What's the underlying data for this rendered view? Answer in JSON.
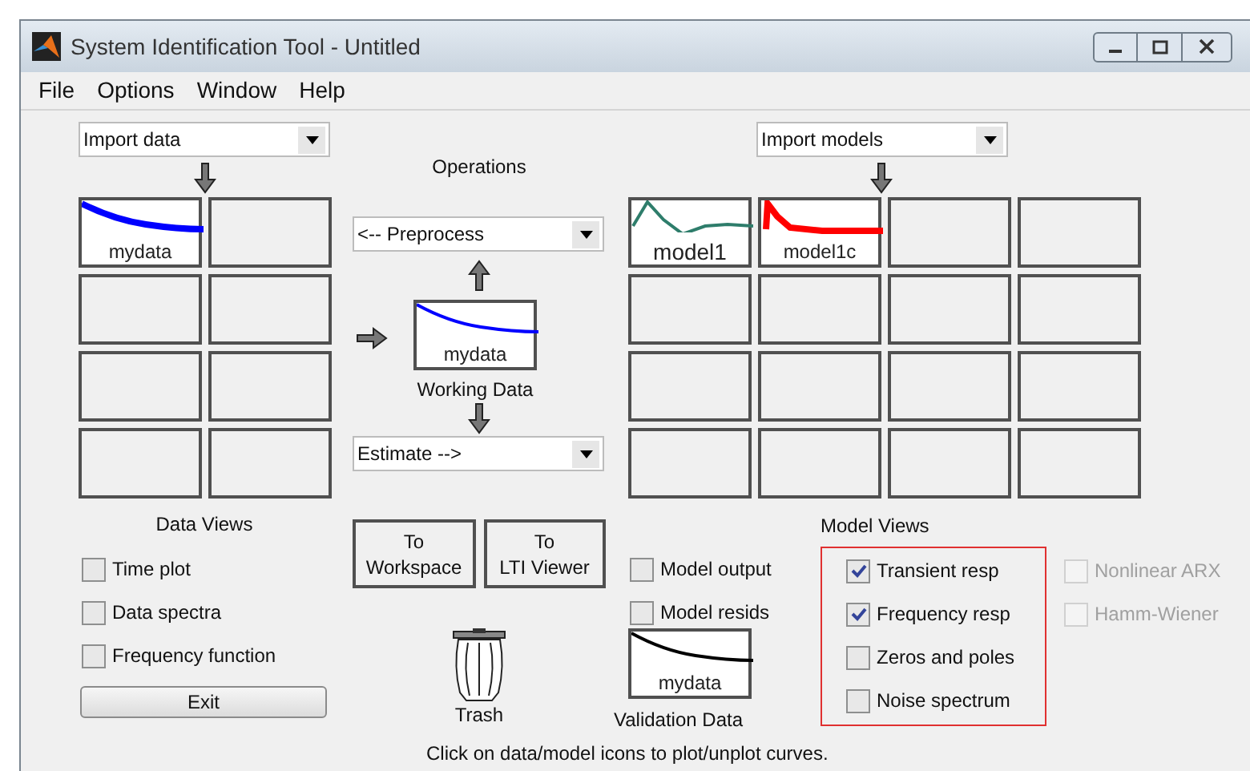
{
  "window": {
    "title": "System Identification Tool - Untitled"
  },
  "menu": [
    "File",
    "Options",
    "Window",
    "Help"
  ],
  "data_panel": {
    "dropdown": "Import data",
    "tiles": [
      {
        "kind": "decay",
        "label": "mydata",
        "color": "#0000ff"
      },
      {
        "kind": "empty"
      },
      {
        "kind": "empty"
      },
      {
        "kind": "empty"
      },
      {
        "kind": "empty"
      },
      {
        "kind": "empty"
      },
      {
        "kind": "empty"
      },
      {
        "kind": "empty"
      }
    ],
    "views_label": "Data Views",
    "options": [
      {
        "label": "Time plot",
        "checked": false
      },
      {
        "label": "Data spectra",
        "checked": false
      },
      {
        "label": "Frequency function",
        "checked": false
      }
    ],
    "exit_button": "Exit"
  },
  "operations": {
    "label": "Operations",
    "preprocess_dropdown": "<-- Preprocess",
    "working_data": {
      "kind": "thin_decay",
      "label": "mydata",
      "color": "#0000ff"
    },
    "working_data_label": "Working Data",
    "estimate_dropdown": "Estimate -->",
    "buttons": [
      [
        "To",
        "Workspace"
      ],
      [
        "To",
        "LTI Viewer"
      ]
    ],
    "trash_label": "Trash"
  },
  "model_panel": {
    "dropdown": "Import models",
    "tiles": [
      {
        "kind": "oscillation",
        "label": "model1",
        "color": "#2e7d6b"
      },
      {
        "kind": "spike",
        "label": "model1c",
        "color": "#ff0000"
      },
      {
        "kind": "empty"
      },
      {
        "kind": "empty"
      },
      {
        "kind": "empty"
      },
      {
        "kind": "empty"
      },
      {
        "kind": "empty"
      },
      {
        "kind": "empty"
      },
      {
        "kind": "empty"
      },
      {
        "kind": "empty"
      },
      {
        "kind": "empty"
      },
      {
        "kind": "empty"
      },
      {
        "kind": "empty"
      },
      {
        "kind": "empty"
      },
      {
        "kind": "empty"
      },
      {
        "kind": "empty"
      }
    ],
    "views_label": "Model Views",
    "options": [
      {
        "label": "Model output",
        "checked": false,
        "disabled": false
      },
      {
        "label": "Model resids",
        "checked": false,
        "disabled": false
      }
    ],
    "highlighted_options": [
      {
        "label": "Transient resp",
        "checked": true,
        "disabled": false
      },
      {
        "label": "Frequency resp",
        "checked": true,
        "disabled": false
      },
      {
        "label": "Zeros and poles",
        "checked": false,
        "disabled": false
      },
      {
        "label": "Noise spectrum",
        "checked": false,
        "disabled": false
      }
    ],
    "extra_options": [
      {
        "label": "Nonlinear ARX",
        "checked": false,
        "disabled": true
      },
      {
        "label": "Hamm-Wiener",
        "checked": false,
        "disabled": true
      }
    ],
    "validation_data": {
      "kind": "thin_decay",
      "label": "mydata",
      "color": "#000000"
    },
    "validation_label": "Validation Data"
  },
  "status": "Click on data/model icons to plot/unplot curves."
}
